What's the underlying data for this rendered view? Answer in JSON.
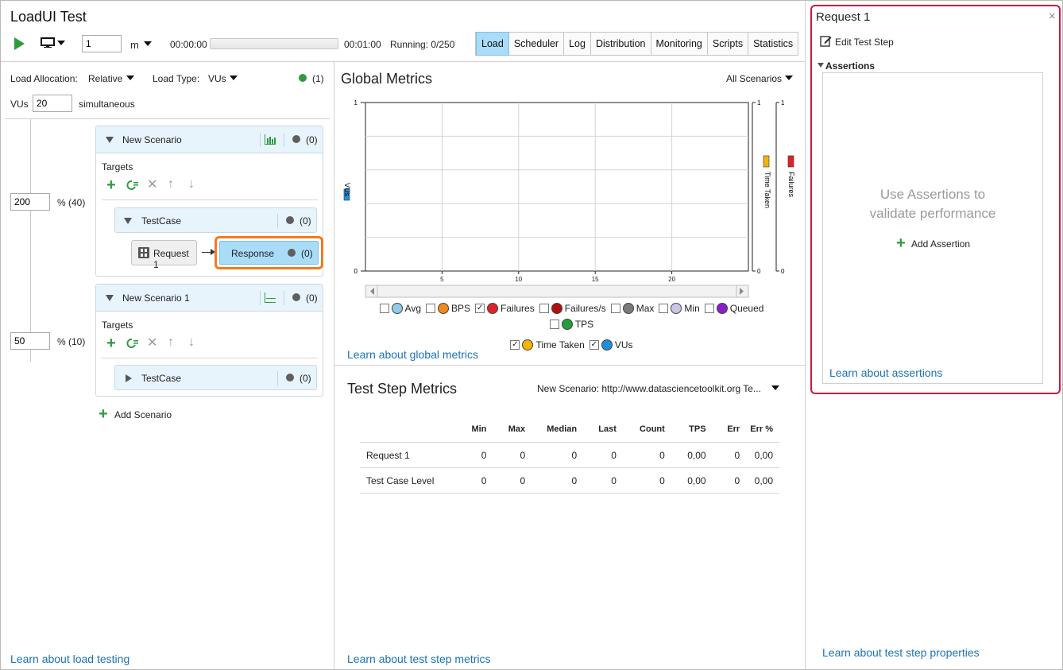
{
  "app": {
    "title": "LoadUI Test"
  },
  "toolbar": {
    "duration_value": "1",
    "duration_unit": "m",
    "time_start": "00:00:00",
    "time_end": "00:01:00",
    "running": "Running: 0/250",
    "progress": 0
  },
  "tabs": [
    {
      "label": "Load",
      "active": true
    },
    {
      "label": "Scheduler"
    },
    {
      "label": "Log"
    },
    {
      "label": "Distribution"
    },
    {
      "label": "Monitoring"
    },
    {
      "label": "Scripts"
    },
    {
      "label": "Statistics"
    }
  ],
  "load": {
    "allocation_label": "Load Allocation:",
    "allocation_value": "Relative",
    "type_label": "Load Type:",
    "type_value": "VUs",
    "status_count": "(1)",
    "vus_label": "VUs",
    "vus_value": "20",
    "vus_suffix": "simultaneous",
    "scenario1_pct_value": "200",
    "scenario1_pct": "% (40)",
    "scenario2_pct_value": "50",
    "scenario2_pct": "% (10)",
    "learn_link": "Learn about load testing",
    "add_scenario": "Add Scenario"
  },
  "scenarios": [
    {
      "name": "New Scenario",
      "count": "(0)",
      "targets_label": "Targets",
      "testcase": "TestCase",
      "testcase_count": "(0)",
      "request": "Request 1",
      "response": "Response",
      "response_count": "(0)"
    },
    {
      "name": "New Scenario 1",
      "count": "(0)",
      "targets_label": "Targets",
      "testcase": "TestCase",
      "testcase_count": "(0)"
    }
  ],
  "global_metrics": {
    "title": "Global Metrics",
    "filter": "All Scenarios",
    "learn_link": "Learn about global metrics",
    "legend": [
      {
        "label": "Avg",
        "color": "#8fcbea",
        "checked": false
      },
      {
        "label": "BPS",
        "color": "#f08a1c",
        "checked": false
      },
      {
        "label": "Failures",
        "color": "#e3202a",
        "checked": true
      },
      {
        "label": "Failures/s",
        "color": "#b01010",
        "checked": false
      },
      {
        "label": "Max",
        "color": "#7a7a7a",
        "checked": false
      },
      {
        "label": "Min",
        "color": "#c9c6e8",
        "checked": false
      },
      {
        "label": "Queued",
        "color": "#8a1ec9",
        "checked": false
      },
      {
        "label": "TPS",
        "color": "#21a03a",
        "checked": false
      },
      {
        "label": "Time Taken",
        "color": "#f4b400",
        "checked": true
      },
      {
        "label": "VUs",
        "color": "#1e8fe0",
        "checked": true
      }
    ]
  },
  "chart_data": {
    "type": "line",
    "x_ticks": [
      "5",
      "10",
      "15",
      "20"
    ],
    "xlim": [
      0,
      25
    ],
    "axes": [
      {
        "label": "VUs",
        "range": [
          0,
          1
        ],
        "ticks": [
          "0",
          "1"
        ],
        "color": "#1e8fe0"
      },
      {
        "label": "Time Taken",
        "range": [
          0,
          1
        ],
        "ticks": [
          "0",
          "1"
        ],
        "color": "#f4b400"
      },
      {
        "label": "Failures",
        "range": [
          0,
          1
        ],
        "ticks": [
          "0",
          "1"
        ],
        "color": "#e3202a"
      }
    ],
    "series": [],
    "grid": true
  },
  "step_metrics": {
    "title": "Test Step Metrics",
    "filter": "New Scenario: http://www.datasciencetoolkit.org Te...",
    "columns": [
      "Min",
      "Max",
      "Median",
      "Last",
      "Count",
      "TPS",
      "Err",
      "Err %"
    ],
    "rows": [
      {
        "label": "Request 1",
        "values": [
          "0",
          "0",
          "0",
          "0",
          "0",
          "0,00",
          "0",
          "0,00"
        ]
      },
      {
        "label": "Test Case Level",
        "values": [
          "0",
          "0",
          "0",
          "0",
          "0",
          "0,00",
          "0",
          "0,00"
        ]
      }
    ],
    "learn_link": "Learn about test step metrics"
  },
  "right_panel": {
    "title": "Request 1",
    "close": "×",
    "edit": "Edit Test Step",
    "assertions_label": "Assertions",
    "empty_line1": "Use Assertions to",
    "empty_line2": "validate performance",
    "add_assertion": "Add Assertion",
    "learn_assertions": "Learn about assertions",
    "learn_properties": "Learn about test step properties"
  }
}
